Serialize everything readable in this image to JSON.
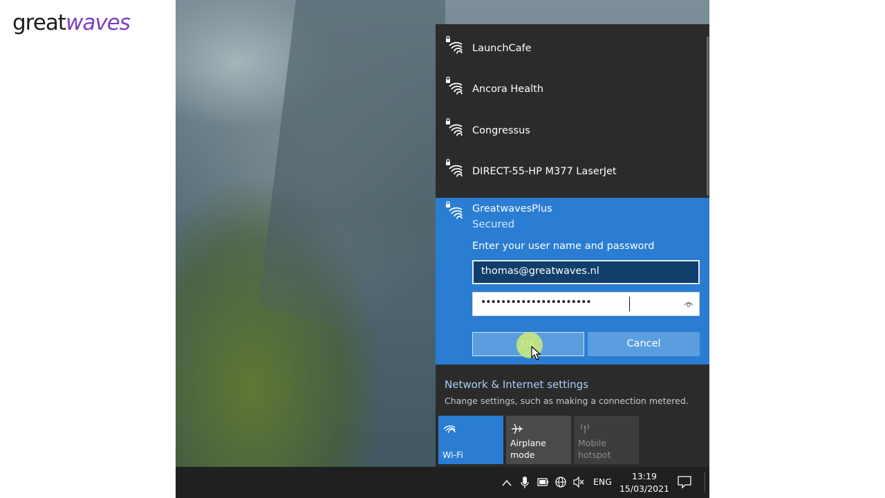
{
  "brand": {
    "part1": "great",
    "part2": "waves"
  },
  "wifi_flyout": {
    "networks": [
      {
        "name": "LaunchCafe",
        "icon": "wifi-secured-icon"
      },
      {
        "name": "Ancora Health",
        "icon": "wifi-secured-icon"
      },
      {
        "name": "Congressus",
        "icon": "wifi-secured-icon"
      },
      {
        "name": "DIRECT-55-HP M377 LaserJet",
        "icon": "wifi-secured-icon"
      }
    ],
    "selected": {
      "name": "GreatwavesPlus",
      "status": "Secured",
      "prompt": "Enter your user name and password",
      "username": "thomas@greatwaves.nl",
      "password_mask": "••••••••••••••••••••••",
      "ok_label": "OK",
      "cancel_label": "Cancel"
    },
    "settings_title": "Network & Internet settings",
    "settings_subtitle": "Change settings, such as making a connection metered.",
    "quick_actions": [
      {
        "label": "Wi-Fi",
        "icon": "wifi-icon",
        "state": "on"
      },
      {
        "label": "Airplane mode",
        "icon": "airplane-icon",
        "state": "off"
      },
      {
        "label": "Mobile hotspot",
        "icon": "hotspot-icon",
        "state": "disabled"
      }
    ]
  },
  "taskbar": {
    "language": "ENG",
    "time": "13:19",
    "date": "15/03/2021",
    "tray_icons": [
      "chevron-up-icon",
      "microphone-icon",
      "battery-icon",
      "network-globe-icon",
      "volume-muted-icon",
      "notification-icon"
    ]
  },
  "colors": {
    "accent": "#2a7dd2",
    "flyout_bg": "#2b2b2b",
    "taskbar_bg": "#1f2020",
    "brand_purple": "#7b3fbf"
  }
}
